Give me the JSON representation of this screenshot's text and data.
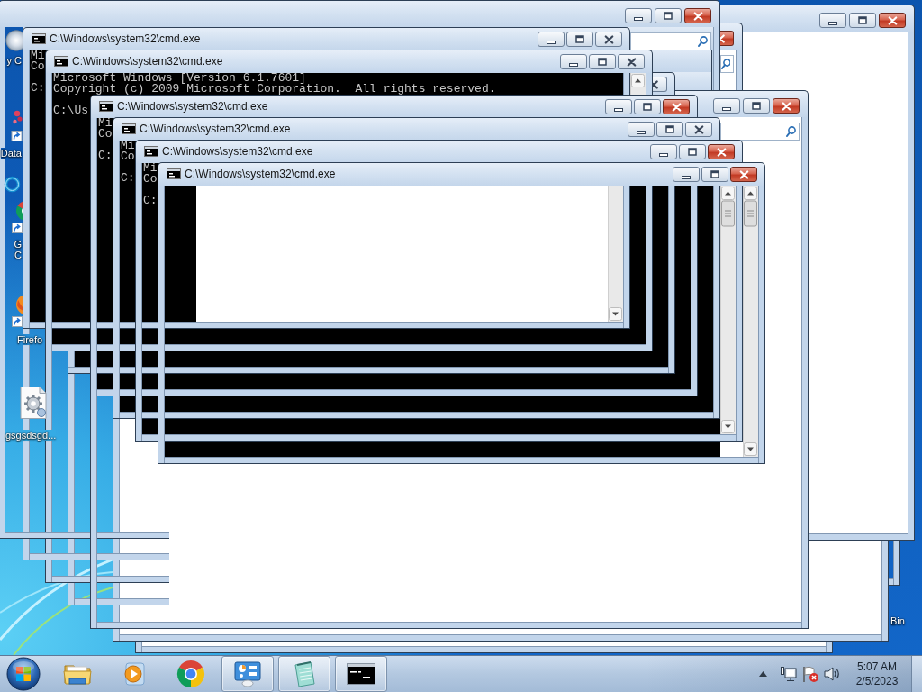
{
  "desktop_icons": [
    {
      "label_lines": [
        "y C"
      ]
    },
    {
      "label_lines": [
        "Data"
      ]
    },
    {
      "label_lines": [
        "G",
        "C"
      ]
    },
    {
      "label_lines": [
        "Firefo"
      ]
    },
    {
      "label_lines": [
        "gsgsdsgd..."
      ]
    },
    {
      "label_lines": [
        "Bin"
      ]
    }
  ],
  "windows": [
    {
      "kind": "explorer"
    },
    {
      "kind": "explorer"
    },
    {
      "kind": "explorer"
    },
    {
      "kind": "explorer"
    },
    {
      "kind": "explorer"
    },
    {
      "kind": "plain",
      "active": true
    },
    {
      "kind": "explorer",
      "active": true
    },
    {
      "kind": "explorer",
      "active": true
    },
    {
      "kind": "explorer",
      "active": true
    },
    {
      "kind": "console",
      "title": "C:\\Windows\\system32\\cmd.exe",
      "active": false,
      "lines": [
        {
          "kind": "text",
          "text": "Mi"
        },
        {
          "kind": "text",
          "text": "Co"
        },
        {
          "kind": "prompt",
          "text": "C:"
        }
      ]
    },
    {
      "kind": "console",
      "active": false
    },
    {
      "kind": "console",
      "title": "C:\\Windows\\system32\\cmd.exe",
      "active": false,
      "lines": [
        {
          "kind": "text",
          "text": "Microsoft Windows [Version 6.1.7601]"
        },
        {
          "kind": "text",
          "text": "Copyright (c) 2009 Microsoft Corporation.  All rights reserved."
        },
        {
          "kind": "prompt",
          "text": "C:\\Us"
        }
      ]
    },
    {
      "kind": "console",
      "title": "C:\\Windows\\system32\\cmd.exe",
      "active": true,
      "lines": [
        {
          "kind": "text",
          "text": "Mi"
        },
        {
          "kind": "text",
          "text": "Co"
        },
        {
          "kind": "prompt",
          "text": "C:"
        }
      ]
    },
    {
      "kind": "console",
      "title": "C:\\Windows\\system32\\cmd.exe",
      "active": false,
      "lines": [
        {
          "kind": "text",
          "text": "Mi"
        },
        {
          "kind": "text",
          "text": "Co"
        },
        {
          "kind": "prompt",
          "text": "C:"
        }
      ]
    },
    {
      "kind": "console",
      "title": "C:\\Windows\\system32\\cmd.exe",
      "active": true,
      "lines": [
        {
          "kind": "text",
          "text": "Mi"
        },
        {
          "kind": "text",
          "text": "Co"
        },
        {
          "kind": "prompt",
          "text": "C:"
        }
      ]
    },
    {
      "kind": "console",
      "title": "C:\\Windows\\system32\\cmd.exe",
      "active": true
    }
  ],
  "taskbar": {
    "items": [
      {
        "running": false
      },
      {
        "running": false
      },
      {
        "running": false
      },
      {
        "running": true
      },
      {
        "running": true
      },
      {
        "running": true
      }
    ],
    "clock": {
      "time": "5:07 AM",
      "date": "2/5/2023"
    }
  }
}
